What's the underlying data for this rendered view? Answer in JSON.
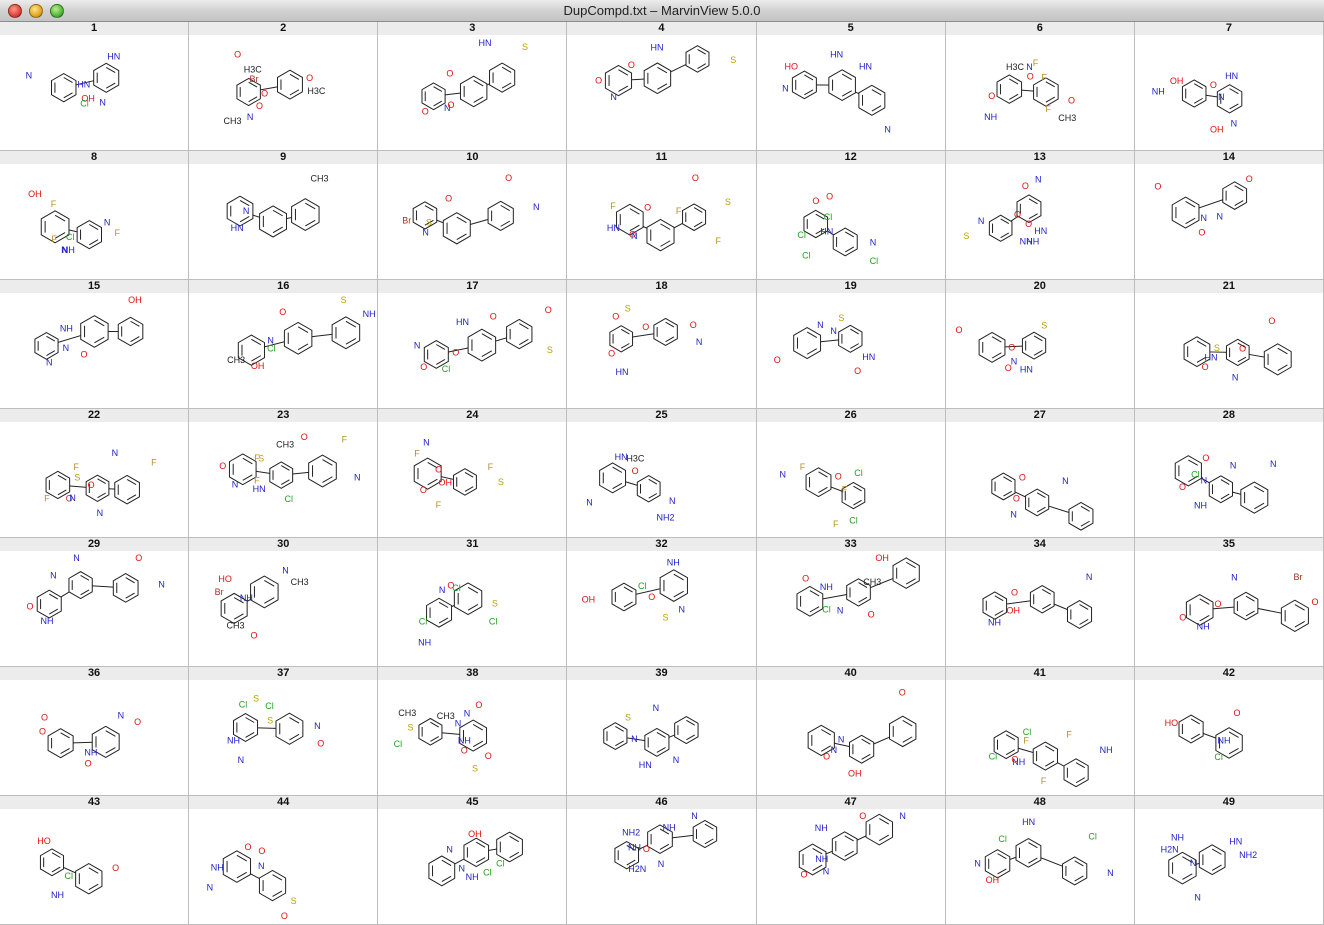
{
  "window": {
    "title": "DupCompd.txt – MarvinView 5.0.0"
  },
  "colors": {
    "bond": "#222222",
    "nitrogen": "#2020c8",
    "oxygen": "#e01010",
    "chlorine": "#20a020",
    "fluorine": "#b89020",
    "bromine": "#a03020",
    "sulfur": "#b8a000",
    "header_bg": "#ececec"
  },
  "cells": [
    {
      "n": "1",
      "atoms": [
        "HN",
        "N",
        "N",
        "HN",
        "OH",
        "Cl"
      ]
    },
    {
      "n": "2",
      "atoms": [
        "O",
        "O",
        "O",
        "O",
        "N",
        "Br",
        "H3C",
        "H3C",
        "CH3"
      ]
    },
    {
      "n": "3",
      "atoms": [
        "O",
        "O",
        "S",
        "N",
        "O",
        "HN"
      ]
    },
    {
      "n": "4",
      "atoms": [
        "O",
        "HN",
        "S",
        "N",
        "O"
      ]
    },
    {
      "n": "5",
      "atoms": [
        "HO",
        "HN",
        "N",
        "N",
        "HN"
      ]
    },
    {
      "n": "6",
      "atoms": [
        "H3C",
        "O",
        "NH",
        "O",
        "N",
        "CH3",
        "O",
        "F",
        "F",
        "F"
      ]
    },
    {
      "n": "7",
      "atoms": [
        "O",
        "N",
        "NH",
        "HN",
        "N",
        "OH",
        "OH"
      ]
    },
    {
      "n": "8",
      "atoms": [
        "Cl",
        "NH",
        "OH",
        "N",
        "N",
        "F",
        "F",
        "F"
      ]
    },
    {
      "n": "9",
      "atoms": [
        "HN",
        "N",
        "CH3"
      ]
    },
    {
      "n": "10",
      "atoms": [
        "Br",
        "O",
        "N",
        "N",
        "S",
        "O"
      ]
    },
    {
      "n": "11",
      "atoms": [
        "F",
        "F",
        "F",
        "HN",
        "O",
        "S",
        "N",
        "O",
        "O"
      ]
    },
    {
      "n": "12",
      "atoms": [
        "O",
        "N",
        "Cl",
        "HN",
        "O",
        "Cl",
        "Cl",
        "Cl"
      ]
    },
    {
      "n": "13",
      "atoms": [
        "O",
        "HN",
        "S",
        "O",
        "O",
        "NH",
        "N",
        "N",
        "NH"
      ]
    },
    {
      "n": "14",
      "atoms": [
        "N",
        "N",
        "O",
        "O",
        "O"
      ]
    },
    {
      "n": "15",
      "atoms": [
        "N",
        "NH",
        "OH",
        "N",
        "O"
      ]
    },
    {
      "n": "16",
      "atoms": [
        "CH3",
        "O",
        "NH",
        "OH",
        "N",
        "S",
        "Cl"
      ]
    },
    {
      "n": "17",
      "atoms": [
        "N",
        "O",
        "S",
        "O",
        "HN",
        "O",
        "Cl",
        "O"
      ]
    },
    {
      "n": "18",
      "atoms": [
        "O",
        "O",
        "HN",
        "O",
        "S",
        "N",
        "O"
      ]
    },
    {
      "n": "19",
      "atoms": [
        "N",
        "HN",
        "O",
        "S",
        "N",
        "O"
      ]
    },
    {
      "n": "20",
      "atoms": [
        "O",
        "HN",
        "O",
        "S",
        "N",
        "O"
      ]
    },
    {
      "n": "21",
      "atoms": [
        "O",
        "HN",
        "O",
        "S",
        "N",
        "O"
      ]
    },
    {
      "n": "22",
      "atoms": [
        "F",
        "F",
        "F",
        "O",
        "N",
        "N",
        "S",
        "N",
        "O"
      ]
    },
    {
      "n": "23",
      "atoms": [
        "O",
        "CH3",
        "N",
        "N",
        "F",
        "F",
        "F",
        "HN",
        "O",
        "S",
        "Cl"
      ]
    },
    {
      "n": "24",
      "atoms": [
        "F",
        "F",
        "F",
        "OH",
        "N",
        "S",
        "O",
        "O"
      ]
    },
    {
      "n": "25",
      "atoms": [
        "HN",
        "N",
        "N",
        "O",
        "H3C",
        "NH2"
      ]
    },
    {
      "n": "26",
      "atoms": [
        "O",
        "Cl",
        "N",
        "Cl",
        "F",
        "F",
        "F"
      ]
    },
    {
      "n": "27",
      "atoms": [
        "O",
        "N",
        "N",
        "O"
      ]
    },
    {
      "n": "28",
      "atoms": [
        "O",
        "Cl",
        "N",
        "N",
        "NH",
        "N",
        "O"
      ]
    },
    {
      "n": "29",
      "atoms": [
        "O",
        "N",
        "N",
        "NH",
        "N",
        "O"
      ]
    },
    {
      "n": "30",
      "atoms": [
        "Br",
        "N",
        "O",
        "NH",
        "HO",
        "CH3",
        "CH3"
      ]
    },
    {
      "n": "31",
      "atoms": [
        "N",
        "S",
        "NH",
        "O",
        "Cl",
        "Cl",
        "Cl"
      ]
    },
    {
      "n": "32",
      "atoms": [
        "Cl",
        "N",
        "OH",
        "NH",
        "O",
        "S"
      ]
    },
    {
      "n": "33",
      "atoms": [
        "Cl",
        "N",
        "OH",
        "NH",
        "O",
        "CH3",
        "O"
      ]
    },
    {
      "n": "34",
      "atoms": [
        "NH",
        "O",
        "N",
        "OH"
      ]
    },
    {
      "n": "35",
      "atoms": [
        "O",
        "N",
        "O",
        "NH",
        "O",
        "Br"
      ]
    },
    {
      "n": "36",
      "atoms": [
        "O",
        "N",
        "O",
        "NH",
        "O",
        "O"
      ]
    },
    {
      "n": "37",
      "atoms": [
        "Cl",
        "N",
        "N",
        "S",
        "S",
        "O",
        "NH",
        "Cl"
      ]
    },
    {
      "n": "38",
      "atoms": [
        "CH3",
        "O",
        "Cl",
        "N",
        "N",
        "S",
        "S",
        "O",
        "NH",
        "O",
        "CH3"
      ]
    },
    {
      "n": "39",
      "atoms": [
        "N",
        "HN",
        "N",
        "S",
        "N"
      ]
    },
    {
      "n": "40",
      "atoms": [
        "O",
        "N",
        "O",
        "N",
        "OH"
      ]
    },
    {
      "n": "41",
      "atoms": [
        "Cl",
        "Cl",
        "NH",
        "O",
        "NH",
        "F",
        "F",
        "F"
      ]
    },
    {
      "n": "42",
      "atoms": [
        "HO",
        "O",
        "NH",
        "Cl"
      ]
    },
    {
      "n": "43",
      "atoms": [
        "HO",
        "O",
        "NH",
        "Cl"
      ]
    },
    {
      "n": "44",
      "atoms": [
        "O",
        "S",
        "N",
        "N",
        "O",
        "O",
        "NH"
      ]
    },
    {
      "n": "45",
      "atoms": [
        "N",
        "NH",
        "OH",
        "N",
        "Cl",
        "Cl"
      ]
    },
    {
      "n": "46",
      "atoms": [
        "H2N",
        "NH",
        "N",
        "O",
        "N",
        "NH",
        "NH2"
      ]
    },
    {
      "n": "47",
      "atoms": [
        "O",
        "NH",
        "N",
        "N",
        "NH",
        "O"
      ]
    },
    {
      "n": "48",
      "atoms": [
        "N",
        "HN",
        "N",
        "OH",
        "Cl",
        "Cl"
      ]
    },
    {
      "n": "49",
      "atoms": [
        "H2N",
        "HN",
        "N",
        "N",
        "NH",
        "NH2"
      ]
    }
  ]
}
